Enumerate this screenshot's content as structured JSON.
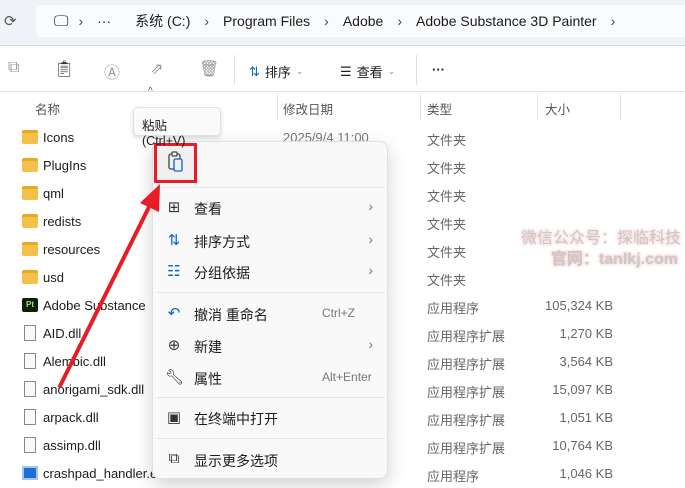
{
  "address": {
    "breadcrumbs": [
      "系统 (C:)",
      "Program Files",
      "Adobe",
      "Adobe Substance 3D Painter"
    ],
    "overflow": "···"
  },
  "toolbar": {
    "sort_label": "排序",
    "view_label": "查看",
    "more": "···"
  },
  "columns": {
    "name": "名称",
    "date": "修改日期",
    "type": "类型",
    "size": "大小"
  },
  "files": [
    {
      "name": "Icons",
      "date": "2025/9/4 11:00",
      "type": "文件夹",
      "size": "",
      "icon": "folder"
    },
    {
      "name": "PlugIns",
      "date": "",
      "type": "文件夹",
      "size": "",
      "icon": "folder"
    },
    {
      "name": "qml",
      "date": "",
      "type": "文件夹",
      "size": "",
      "icon": "folder"
    },
    {
      "name": "redists",
      "date": "",
      "type": "文件夹",
      "size": "",
      "icon": "folder"
    },
    {
      "name": "resources",
      "date": "",
      "type": "文件夹",
      "size": "",
      "icon": "folder"
    },
    {
      "name": "usd",
      "date": "",
      "type": "文件夹",
      "size": "",
      "icon": "folder"
    },
    {
      "name": "Adobe Substance",
      "date": "",
      "type": "应用程序",
      "size": "105,324 KB",
      "icon": "pt"
    },
    {
      "name": "AID.dll",
      "date": "",
      "type": "应用程序扩展",
      "size": "1,270 KB",
      "icon": "dll"
    },
    {
      "name": "Alembic.dll",
      "date": "",
      "type": "应用程序扩展",
      "size": "3,564 KB",
      "icon": "dll"
    },
    {
      "name": "anorigami_sdk.dll",
      "date": "",
      "type": "应用程序扩展",
      "size": "15,097 KB",
      "icon": "dll"
    },
    {
      "name": "arpack.dll",
      "date": "",
      "type": "应用程序扩展",
      "size": "1,051 KB",
      "icon": "dll"
    },
    {
      "name": "assimp.dll",
      "date": "",
      "type": "应用程序扩展",
      "size": "10,764 KB",
      "icon": "dll"
    },
    {
      "name": "crashpad_handler.exe",
      "date": "",
      "type": "应用程序",
      "size": "1,046 KB",
      "icon": "exe"
    }
  ],
  "tooltip": "粘贴 (Ctrl+V)",
  "menu": {
    "items": [
      {
        "label": "查看",
        "icon": "grid-icon",
        "shortcut": "",
        "submenu": true
      },
      {
        "label": "排序方式",
        "icon": "sort-icon",
        "shortcut": "",
        "submenu": true
      },
      {
        "label": "分组依据",
        "icon": "group-icon",
        "shortcut": "",
        "submenu": true
      },
      {
        "label": "撤消 重命名",
        "icon": "undo-icon",
        "shortcut": "Ctrl+Z",
        "submenu": false
      },
      {
        "label": "新建",
        "icon": "plus-circle-icon",
        "shortcut": "",
        "submenu": true
      },
      {
        "label": "属性",
        "icon": "wrench-icon",
        "shortcut": "Alt+Enter",
        "submenu": false
      },
      {
        "label": "在终端中打开",
        "icon": "terminal-icon",
        "shortcut": "",
        "submenu": false
      },
      {
        "label": "显示更多选项",
        "icon": "share-more-icon",
        "shortcut": "",
        "submenu": false
      }
    ]
  },
  "watermark": {
    "line1": "微信公众号：探临科技",
    "line2": "官网：tanlkj.com"
  },
  "colors": {
    "highlight": "#e81c24",
    "accent": "#0a64c8"
  }
}
